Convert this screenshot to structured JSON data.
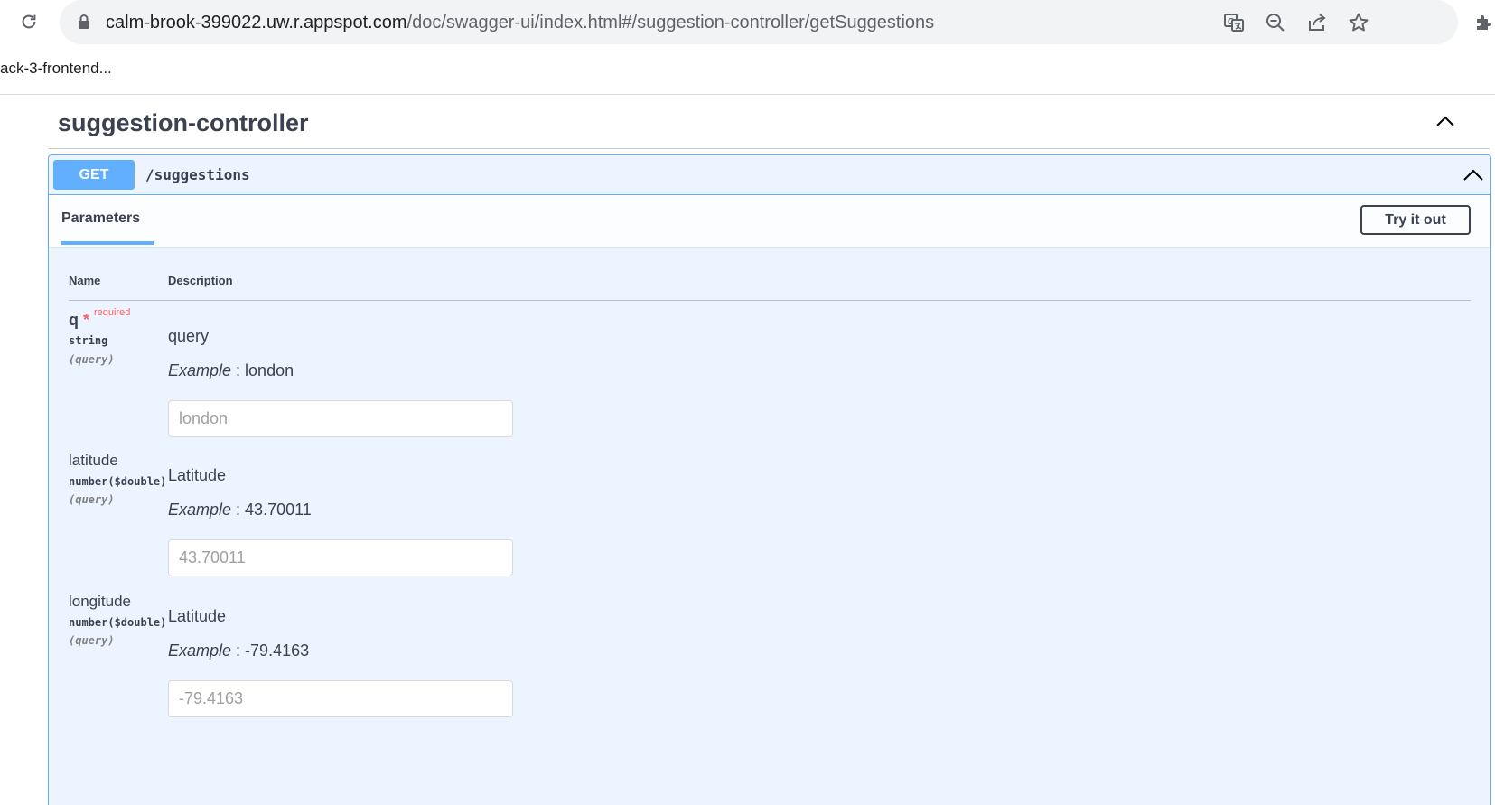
{
  "browser": {
    "url_host": "calm-brook-399022.uw.r.appspot.com",
    "url_path": "/doc/swagger-ui/index.html#/suggestion-controller/getSuggestions",
    "bookmark_label": "ack-3-frontend..."
  },
  "tag": {
    "title": "suggestion-controller"
  },
  "operation": {
    "method": "GET",
    "path": "/suggestions",
    "tab_label": "Parameters",
    "try_button_label": "Try it out",
    "col_name": "Name",
    "col_description": "Description"
  },
  "params": [
    {
      "name": "q",
      "star": "*",
      "required_label": "required",
      "type": "string",
      "in": "(query)",
      "description": "query",
      "example_label": "Example",
      "example_sep": " : ",
      "example_value": "london",
      "placeholder": "london"
    },
    {
      "name": "latitude",
      "type": "number($double)",
      "in": "(query)",
      "description": "Latitude",
      "example_label": "Example",
      "example_sep": " : ",
      "example_value": "43.70011",
      "placeholder": "43.70011"
    },
    {
      "name": "longitude",
      "type": "number($double)",
      "in": "(query)",
      "description": "Latitude",
      "example_label": "Example",
      "example_sep": " : ",
      "example_value": "-79.4163",
      "placeholder": "-79.4163"
    }
  ],
  "colors": {
    "get_blue": "#61affe",
    "required_red": "#ff6060",
    "text": "#3b4151"
  }
}
